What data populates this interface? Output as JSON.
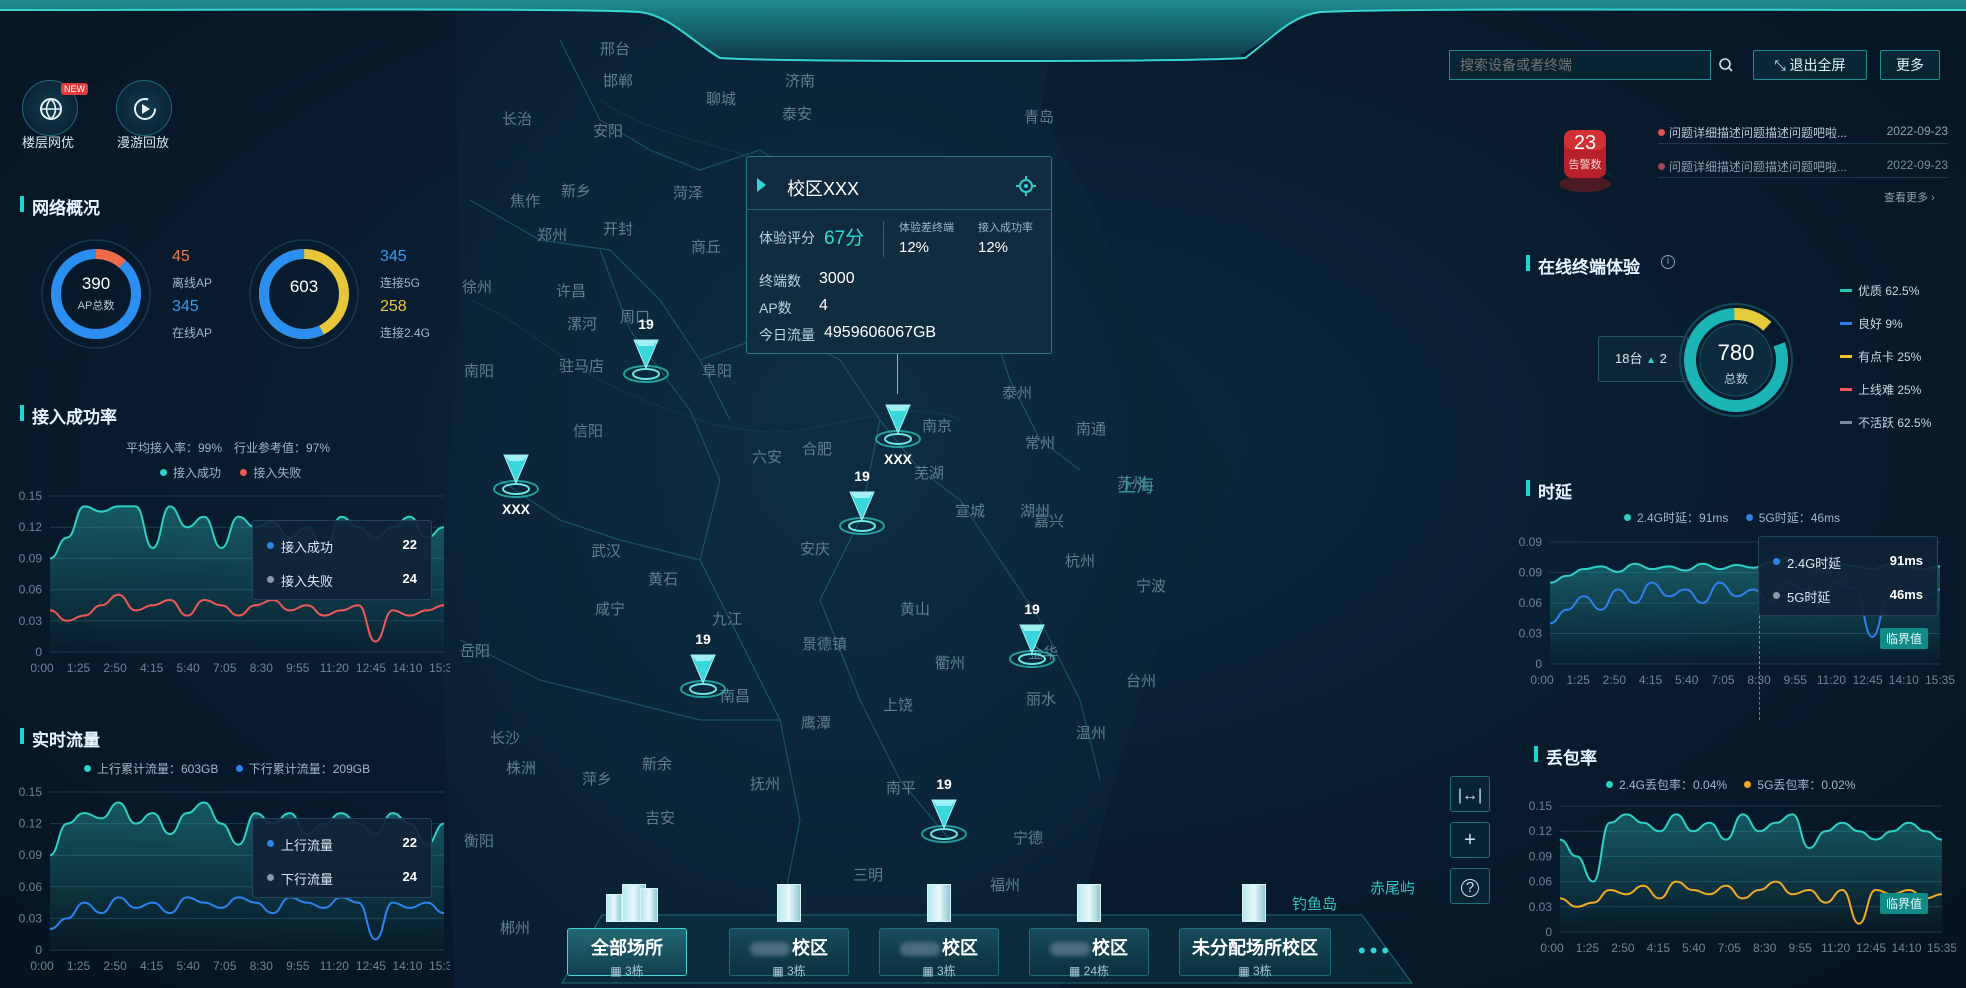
{
  "toolbar": {
    "floor_label": "楼层网优",
    "floor_badge": "NEW",
    "roam_label": "漫游回放"
  },
  "search": {
    "placeholder": "搜索设备或者终端"
  },
  "buttons": {
    "exit_fullscreen": "退出全屏",
    "more": "更多"
  },
  "alarm": {
    "count": "23",
    "label": "告警数",
    "items": [
      {
        "text": "问题详细描述问题描述问题吧啦...",
        "date": "2022-09-23"
      },
      {
        "text": "问题详细描述问题描述问题吧啦...",
        "date": "2022-09-23"
      }
    ],
    "view_more": "查看更多"
  },
  "network": {
    "title": "网络概况",
    "ap_total": "390",
    "ap_total_label": "AP总数",
    "offline_ap": "45",
    "offline_ap_label": "离线AP",
    "online_ap": "345",
    "online_ap_label": "在线AP",
    "conn_total": "603",
    "conn_5g": "345",
    "conn_5g_label": "连接5G",
    "conn_24g": "258",
    "conn_24g_label": "连接2.4G",
    "offline_fraction": 0.115,
    "conn_5g_fraction": 0.572
  },
  "access": {
    "title": "接入成功率",
    "summary": "平均接入率：99%　行业参考值：97%",
    "legend": [
      "接入成功",
      "接入失败"
    ],
    "tooltip": [
      {
        "name": "接入成功",
        "value": "22"
      },
      {
        "name": "接入失败",
        "value": "24"
      }
    ]
  },
  "traffic": {
    "title": "实时流量",
    "legend": [
      "上行累计流量：603GB",
      "下行累计流量：209GB"
    ],
    "tooltip": [
      {
        "name": "上行流量",
        "value": "22"
      },
      {
        "name": "下行流量",
        "value": "24"
      }
    ]
  },
  "popup": {
    "title": "校区XXX",
    "score_label": "体验评分",
    "score": "67分",
    "bad_label": "体验差终端",
    "bad_value": "12%",
    "rate_label": "接入成功率",
    "rate_value": "12%",
    "terminals_label": "终端数",
    "terminals": "3000",
    "ap_label": "AP数",
    "ap": "4",
    "traffic_label": "今日流量",
    "traffic": "4959606067GB"
  },
  "markers": [
    {
      "label": "19"
    },
    {
      "label": "XXX"
    },
    {
      "label": "XXX"
    },
    {
      "label": "19"
    },
    {
      "label": "19"
    },
    {
      "label": "19"
    },
    {
      "label": "19"
    }
  ],
  "map_labels": {
    "cities": [
      "邢台",
      "邯郸",
      "聊城",
      "济南",
      "长治",
      "安阳",
      "泰安",
      "青岛",
      "新乡",
      "焦作",
      "菏泽",
      "郑州",
      "开封",
      "商丘",
      "许昌",
      "漯河",
      "周口",
      "南阳",
      "驻马店",
      "阜阳",
      "信阳",
      "六安",
      "合肥",
      "南京",
      "泰州",
      "南通",
      "常州",
      "苏州",
      "上海",
      "芜湖",
      "宣城",
      "湖州",
      "嘉兴",
      "杭州",
      "安庆",
      "武汉",
      "黄石",
      "咸宁",
      "九江",
      "黄山",
      "宁波",
      "景德镇",
      "衢州",
      "金华",
      "台州",
      "岳阳",
      "长沙",
      "株洲",
      "南昌",
      "上饶",
      "丽水",
      "温州",
      "鹰潭",
      "抚州",
      "新余",
      "萍乡",
      "衡阳",
      "吉安",
      "南平",
      "宁德",
      "福州",
      "三明",
      "郴州",
      "徐州"
    ],
    "islands": [
      "钓鱼岛",
      "赤尾屿"
    ]
  },
  "campuses": [
    {
      "name": "全部场所",
      "count": "3栋"
    },
    {
      "name": "校区",
      "count": "3栋"
    },
    {
      "name": "校区",
      "count": "3栋"
    },
    {
      "name": "校区",
      "count": "24栋"
    },
    {
      "name": "未分配场所校区",
      "count": "3栋"
    }
  ],
  "experience": {
    "title": "在线终端体验",
    "total": "780",
    "total_label": "总数",
    "change": "18台",
    "change_num": "2",
    "legend": [
      {
        "name": "优质 62.5%",
        "color": "#22c7b8"
      },
      {
        "name": "良好 9%",
        "color": "#2f7bf0"
      },
      {
        "name": "有点卡 25%",
        "color": "#f2c230"
      },
      {
        "name": "上线难 25%",
        "color": "#f0575a"
      },
      {
        "name": "不活跃 62.5%",
        "color": "#7a8a99"
      }
    ]
  },
  "latency": {
    "title": "时延",
    "legend": [
      "2.4G时延：91ms",
      "5G时延：46ms"
    ],
    "tooltip": [
      {
        "name": "2.4G时延",
        "value": "91ms"
      },
      {
        "name": "5G时延",
        "value": "46ms"
      }
    ],
    "threshold": "临界值"
  },
  "loss": {
    "title": "丢包率",
    "legend": [
      "2.4G丢包率：0.04%",
      "5G丢包率：0.02%"
    ],
    "threshold": "临界值"
  },
  "chart_data": [
    {
      "type": "area",
      "title": "接入成功率",
      "x": [
        "0:00",
        "1:25",
        "2:50",
        "4:15",
        "5:40",
        "7:05",
        "8:30",
        "9:55",
        "11:20",
        "12:45",
        "14:10",
        "15:35"
      ],
      "ylim": [
        0,
        0.15
      ],
      "yticks": [
        "0",
        "0.03",
        "0.06",
        "0.09",
        "0.12",
        "0.15"
      ],
      "series": [
        {
          "name": "接入成功",
          "color": "#2fd0c7",
          "values": [
            0.09,
            0.11,
            0.14,
            0.135,
            0.14,
            0.14,
            0.1,
            0.14,
            0.12,
            0.13,
            0.1,
            0.13,
            0.12,
            0.125,
            0.11,
            0.12,
            0.1,
            0.13,
            0.12,
            0.11,
            0.12,
            0.13,
            0.11,
            0.12
          ]
        },
        {
          "name": "接入失败",
          "color": "#ee5a5a",
          "values": [
            0.04,
            0.03,
            0.035,
            0.045,
            0.055,
            0.04,
            0.045,
            0.05,
            0.035,
            0.05,
            0.045,
            0.035,
            0.045,
            0.05,
            0.04,
            0.045,
            0.035,
            0.04,
            0.045,
            0.01,
            0.04,
            0.035,
            0.04,
            0.045
          ]
        }
      ]
    },
    {
      "type": "area",
      "title": "实时流量",
      "x": [
        "0:00",
        "1:25",
        "2:50",
        "4:15",
        "5:40",
        "7:05",
        "8:30",
        "9:55",
        "11:20",
        "12:45",
        "14:10",
        "15:35"
      ],
      "ylim": [
        0,
        0.15
      ],
      "yticks": [
        "0",
        "0.03",
        "0.06",
        "0.09",
        "0.12",
        "0.15"
      ],
      "series": [
        {
          "name": "上行流量",
          "color": "#2fd0c7",
          "values": [
            0.09,
            0.12,
            0.13,
            0.125,
            0.14,
            0.12,
            0.13,
            0.11,
            0.13,
            0.14,
            0.12,
            0.1,
            0.13,
            0.12,
            0.13,
            0.11,
            0.12,
            0.13,
            0.12,
            0.11,
            0.13,
            0.12,
            0.1,
            0.12
          ]
        },
        {
          "name": "下行流量",
          "color": "#2e82f0",
          "values": [
            0.02,
            0.03,
            0.045,
            0.035,
            0.05,
            0.04,
            0.045,
            0.035,
            0.05,
            0.045,
            0.04,
            0.05,
            0.045,
            0.035,
            0.05,
            0.045,
            0.04,
            0.05,
            0.045,
            0.01,
            0.045,
            0.04,
            0.045,
            0.035
          ]
        }
      ]
    },
    {
      "type": "area",
      "title": "时延",
      "x": [
        "0:00",
        "1:25",
        "2:50",
        "4:15",
        "5:40",
        "7:05",
        "8:30",
        "9:55",
        "11:20",
        "12:45",
        "14:10",
        "15:35"
      ],
      "ylim": [
        0,
        0.09
      ],
      "yticks": [
        "0",
        "0.03",
        "0.06",
        "0.09",
        "0.09"
      ],
      "series": [
        {
          "name": "2.4G时延",
          "color": "#2fd0c7",
          "values": [
            0.06,
            0.065,
            0.07,
            0.072,
            0.068,
            0.074,
            0.07,
            0.072,
            0.069,
            0.074,
            0.07,
            0.073,
            0.071,
            0.075,
            0.078,
            0.072,
            0.07,
            0.074,
            0.072,
            0.07,
            0.073,
            0.072,
            0.07,
            0.072
          ]
        },
        {
          "name": "5G时延",
          "color": "#2e82f0",
          "values": [
            0.03,
            0.04,
            0.05,
            0.04,
            0.055,
            0.045,
            0.06,
            0.05,
            0.055,
            0.045,
            0.06,
            0.05,
            0.055,
            0.045,
            0.06,
            0.055,
            0.05,
            0.06,
            0.055,
            0.02,
            0.05,
            0.055,
            0.05,
            0.055
          ]
        }
      ]
    },
    {
      "type": "area",
      "title": "丢包率",
      "x": [
        "0:00",
        "1:25",
        "2:50",
        "4:15",
        "5:40",
        "7:05",
        "8:30",
        "9:55",
        "11:20",
        "12:45",
        "14:10",
        "15:35"
      ],
      "ylim": [
        0,
        0.15
      ],
      "yticks": [
        "0",
        "0.03",
        "0.06",
        "0.09",
        "0.12",
        "0.15"
      ],
      "series": [
        {
          "name": "2.4G丢包率",
          "color": "#2fd0c7",
          "values": [
            0.11,
            0.09,
            0.06,
            0.13,
            0.14,
            0.13,
            0.12,
            0.14,
            0.12,
            0.13,
            0.11,
            0.14,
            0.12,
            0.13,
            0.14,
            0.1,
            0.12,
            0.13,
            0.12,
            0.11,
            0.12,
            0.13,
            0.12,
            0.11
          ]
        },
        {
          "name": "5G丢包率",
          "color": "#f2a926",
          "values": [
            0.04,
            0.03,
            0.035,
            0.05,
            0.045,
            0.055,
            0.04,
            0.06,
            0.05,
            0.045,
            0.055,
            0.04,
            0.05,
            0.06,
            0.045,
            0.05,
            0.035,
            0.05,
            0.01,
            0.05,
            0.045,
            0.05,
            0.04,
            0.045
          ]
        }
      ]
    }
  ]
}
